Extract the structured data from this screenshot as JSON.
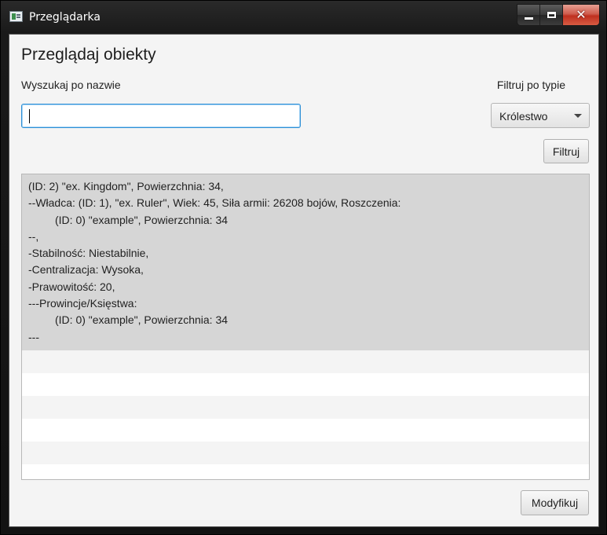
{
  "window": {
    "title": "Przeglądarka",
    "icon": "app-window-icon",
    "controls": {
      "minimize": "minimize-icon",
      "maximize": "maximize-icon",
      "close": "✕"
    }
  },
  "page": {
    "heading": "Przeglądaj obiekty",
    "search": {
      "label": "Wyszukaj po nazwie",
      "value": "",
      "placeholder": ""
    },
    "filter": {
      "label": "Filtruj po typie",
      "selected": "Królestwo",
      "button": "Filtruj"
    },
    "list": {
      "selected_item_lines": [
        "(ID: 2) \"ex. Kingdom\", Powierzchnia: 34,",
        "--Władca: (ID: 1), \"ex. Ruler\", Wiek: 45, Siła armii: 26208 bojów, Roszczenia:",
        "(ID: 0) \"example\", Powierzchnia: 34",
        "--,",
        "-Stabilność: Niestabilnie,",
        "-Centralizacja: Wysoka,",
        "-Prawowitość: 20,",
        "---Prowincje/Księstwa:",
        "(ID: 0) \"example\", Powierzchnia: 34",
        "---"
      ]
    },
    "modify_button": "Modyfikuj"
  }
}
